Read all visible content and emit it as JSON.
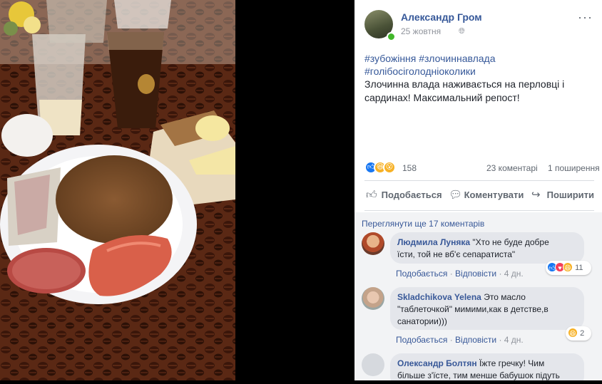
{
  "post": {
    "author": "Александр Гром",
    "date": "25 жовтня",
    "privacy_icon": "globe-icon",
    "more_label": "···",
    "hashtags_line1": "#зубожіння #злочиннавлада",
    "hashtags_line2": "#голібосіголодніоколики",
    "text": "Злочинна влада наживається на перловці і сардинах! Максимальний репост!"
  },
  "stats": {
    "reactions": [
      "like",
      "haha",
      "wow"
    ],
    "reaction_count": "158",
    "comments": "23 коментарі",
    "shares": "1 поширення"
  },
  "actions": {
    "like": "Подобається",
    "comment": "Коментувати",
    "share": "Поширити"
  },
  "comments_section": {
    "view_more": "Переглянути ще 17 коментарів",
    "items": [
      {
        "name": "Людмила Луняка",
        "text_line1": "\"Хто не буде добре",
        "text_line2": "їсти, той не вб'є сепаратиста\"",
        "like": "Подобається",
        "reply": "Відповісти",
        "age": "4 дн.",
        "reaction_count": "11"
      },
      {
        "name": "Skladchikova Yelena",
        "text_line1": "Это масло",
        "text_line2": "\"таблеточкой\" мимими,как в детстве,в",
        "text_line3": "санатории)))",
        "like": "Подобається",
        "reply": "Відповісти",
        "age": "4 дн.",
        "reaction_count": "2"
      },
      {
        "name": "Олександр Болтян",
        "text_line1": "Їжте гречку! Чим",
        "text_line2": "більше з'їсте, тим менше бабушок підуть"
      }
    ]
  },
  "colors": {
    "link": "#365899",
    "like_blue": "#1877f2",
    "love_red": "#f33e58",
    "haha_yellow": "#f7b125",
    "comment_bg": "#f2f3f5"
  }
}
